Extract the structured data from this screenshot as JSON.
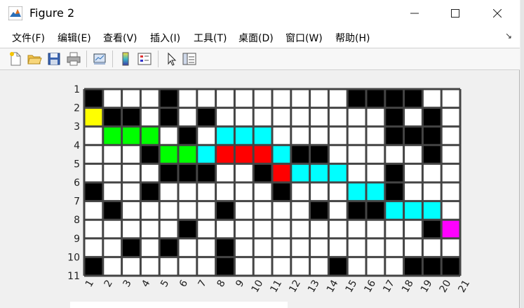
{
  "window": {
    "title": "Figure 2"
  },
  "menu": [
    "文件(F)",
    "编辑(E)",
    "查看(V)",
    "插入(I)",
    "工具(T)",
    "桌面(D)",
    "窗口(W)",
    "帮助(H)"
  ],
  "toolbar": [
    "new-file-icon",
    "open-folder-icon",
    "save-icon",
    "print-icon",
    "link-plot-icon",
    "colorbar-icon",
    "legend-icon",
    "pointer-icon",
    "property-editor-icon"
  ],
  "chart_data": {
    "type": "heatmap",
    "xlabels": [
      "1",
      "2",
      "3",
      "4",
      "5",
      "6",
      "7",
      "8",
      "9",
      "10",
      "11",
      "12",
      "13",
      "14",
      "15",
      "16",
      "17",
      "18",
      "19",
      "20",
      "21"
    ],
    "ylabels": [
      "1",
      "2",
      "3",
      "4",
      "5",
      "6",
      "7",
      "8",
      "9",
      "10",
      "11"
    ],
    "legend_colors": {
      "W": "#ffffff",
      "B": "#000000",
      "Y": "#ffff00",
      "G": "#00ff00",
      "C": "#00ffff",
      "R": "#ff0000",
      "M": "#ff00ff"
    },
    "grid": [
      "BWWWBWWWWWWWWWBBBBWW",
      "YBBWBWBWWWWWWWWWBWBW",
      "WGGGWBWCCCWWWWWWBBBW",
      "WWWBGGCRRRCBBWWWWWBW",
      "WWWWBBBWWBRCCCWWBWWW",
      "BWWBWWWWWWBWWWCCBWWW",
      "WBWWWWWBWWWWBWBBCCCW",
      "WWWWWBWWWWWWWWWWWWBM",
      "WWBWBWWBWWWWWWWWWWWW",
      "BWWWWWWBWWWWWBWWWBBB"
    ]
  }
}
